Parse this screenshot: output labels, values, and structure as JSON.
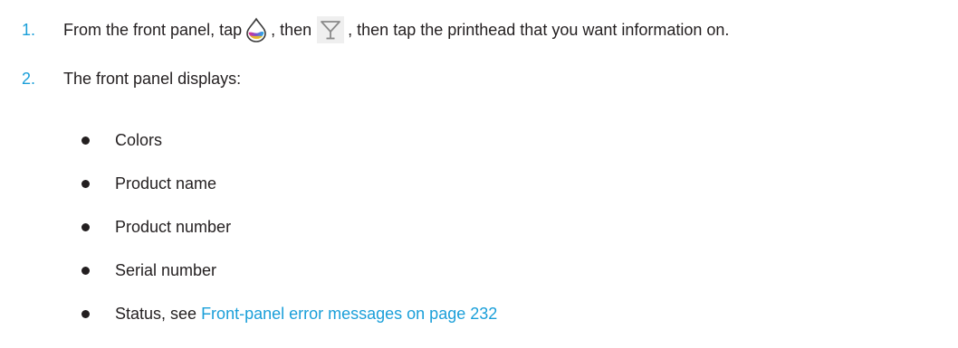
{
  "steps": [
    {
      "number": "1.",
      "text_before_icon1": "From the front panel, tap",
      "icon1": "ink-drop-icon",
      "text_between_icons": ", then",
      "icon2": "printhead-icon",
      "text_after_icon2": ", then tap the printhead that you want information on."
    },
    {
      "number": "2.",
      "text": "The front panel displays:"
    }
  ],
  "bullets": [
    {
      "text": "Colors"
    },
    {
      "text": "Product name"
    },
    {
      "text": "Product number"
    },
    {
      "text": "Serial number"
    },
    {
      "text": "Status, see ",
      "link": "Front-panel error messages on page 232"
    }
  ],
  "colors": {
    "accent": "#1a9fd9",
    "text": "#231f20"
  }
}
